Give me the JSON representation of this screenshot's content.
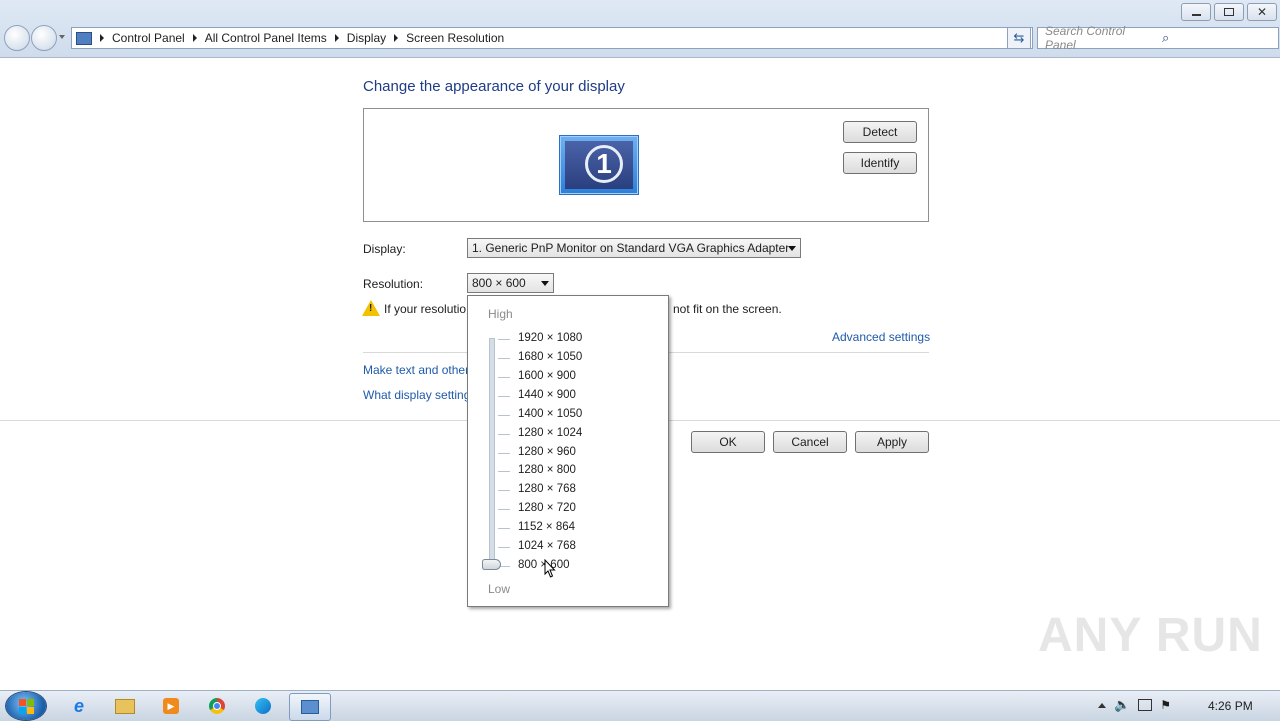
{
  "window": {
    "back_label": "",
    "breadcrumb": [
      "Control Panel",
      "All Control Panel Items",
      "Display",
      "Screen Resolution"
    ],
    "search_placeholder": "Search Control Panel"
  },
  "main": {
    "heading": "Change the appearance of your display",
    "monitor_number": "1",
    "detect_label": "Detect",
    "identify_label": "Identify",
    "display_label": "Display:",
    "display_value": "1. Generic PnP Monitor on Standard VGA Graphics Adapter",
    "resolution_label": "Resolution:",
    "resolution_value": "800 × 600",
    "warning_text_start": "If your resolutio",
    "warning_text_end": "not fit on the screen.",
    "advanced_settings": "Advanced settings",
    "link_text_size": "Make text and other",
    "link_settings": "What display setting",
    "ok_label": "OK",
    "cancel_label": "Cancel",
    "apply_label": "Apply"
  },
  "resolution_popup": {
    "high_label": "High",
    "low_label": "Low",
    "options": [
      "1920 × 1080",
      "1680 × 1050",
      "1600 × 900",
      "1440 × 900",
      "1400 × 1050",
      "1280 × 1024",
      "1280 × 960",
      "1280 × 800",
      "1280 × 768",
      "1280 × 720",
      "1152 × 864",
      "1024 × 768",
      "800 × 600"
    ],
    "selected": "800 × 600"
  },
  "taskbar": {
    "clock": "4:26 PM",
    "icons": [
      "internet-explorer-icon",
      "file-explorer-icon",
      "media-player-icon",
      "chrome-icon",
      "edge-icon",
      "screen-resolution-icon"
    ]
  },
  "watermark": "ANY RUN",
  "colors": {
    "accent": "#1e3c87",
    "link": "#1f5aa9",
    "taskbar": "#c9d5e3"
  }
}
